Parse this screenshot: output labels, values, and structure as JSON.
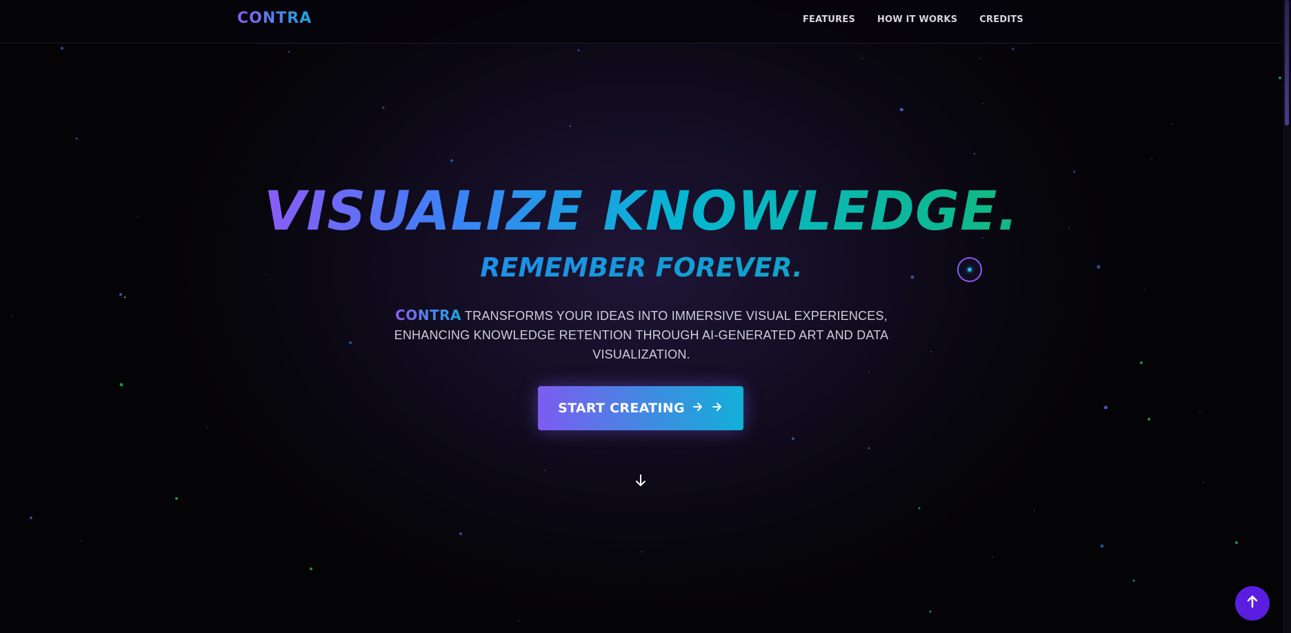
{
  "nav": {
    "logo": "CONTRA",
    "links": [
      {
        "label": "FEATURES"
      },
      {
        "label": "HOW IT WORKS"
      },
      {
        "label": "CREDITS"
      }
    ]
  },
  "hero": {
    "title": "VISUALIZE KNOWLEDGE.",
    "subtitle": "REMEMBER FOREVER.",
    "description_brand": "CONTRA",
    "description_text": "TRANSFORMS YOUR IDEAS INTO IMMERSIVE VISUAL EXPERIENCES, ENHANCING KNOWLEDGE RETENTION THROUGH AI-GENERATED ART AND DATA VISUALIZATION.",
    "cta_label": "START CREATING",
    "cta_icons": [
      "arrow-right-icon",
      "arrow-right-icon"
    ]
  },
  "icons": {
    "scroll_down": "arrow-down-icon",
    "back_to_top": "arrow-up-icon"
  },
  "colors": {
    "gradient_purple": "#8b5cf6",
    "gradient_blue": "#3b82f6",
    "gradient_cyan": "#06b6d4",
    "gradient_green": "#10b981",
    "back_to_top_bg": "#5b1de0"
  }
}
